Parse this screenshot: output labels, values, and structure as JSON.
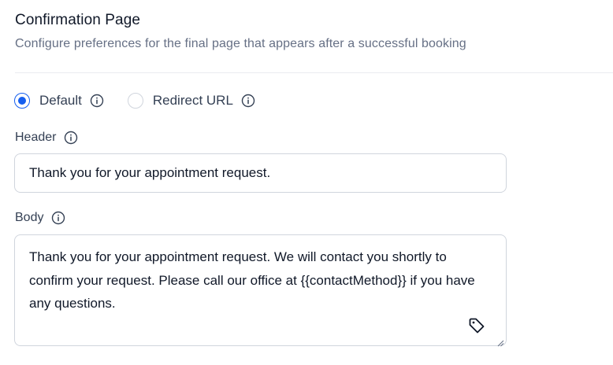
{
  "section": {
    "title": "Confirmation Page",
    "subtitle": "Configure preferences for the final page that appears after a successful booking"
  },
  "radio_options": [
    {
      "label": "Default",
      "checked": true
    },
    {
      "label": "Redirect URL",
      "checked": false
    }
  ],
  "header_field": {
    "label": "Header",
    "value": "Thank you for your appointment request."
  },
  "body_field": {
    "label": "Body",
    "value": "Thank you for your appointment request. We will contact you shortly to confirm your request. Please call our office at {{contactMethod}} if you have any questions."
  },
  "icons": {
    "info": "info-circle-icon",
    "tag": "tag-icon",
    "resize": "resize-handle-icon"
  },
  "colors": {
    "accent": "#155eef",
    "border": "#d0d5dd",
    "muted_text": "#667085",
    "label_text": "#344054",
    "divider": "#eaecf0"
  }
}
